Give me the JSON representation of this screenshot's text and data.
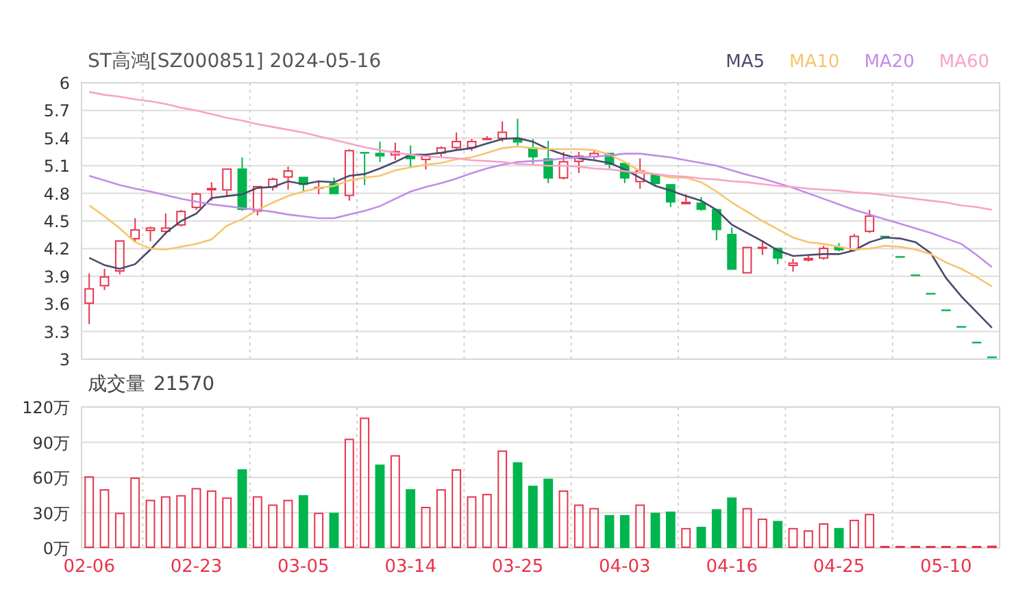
{
  "header": {
    "title": "ST高鸿[SZ000851] 2024-05-16"
  },
  "price_chart": {
    "candles": {
      "chart_data": {
        "type": "candlestick",
        "grid": true,
        "ylim": [
          3,
          6
        ],
        "yticks": [
          3,
          3.3,
          3.6,
          3.9,
          4.2,
          4.5,
          4.8,
          5.1,
          5.4,
          5.7,
          6
        ],
        "categories": [
          null,
          null,
          null,
          null,
          null,
          null,
          null,
          null,
          null,
          null,
          null,
          null,
          null,
          null,
          null,
          null,
          null,
          null,
          null,
          null,
          null,
          null,
          null,
          null,
          null,
          null,
          null,
          null,
          null,
          null,
          null,
          null,
          null,
          null,
          null,
          null,
          null,
          null,
          null,
          null,
          null,
          null,
          null,
          null,
          null,
          null,
          null,
          null,
          null,
          null,
          null,
          null,
          null,
          null,
          null,
          null,
          null,
          null,
          null,
          null
        ],
        "ohlc": [
          [
            3.6,
            3.93,
            3.38,
            3.77
          ],
          [
            3.79,
            3.98,
            3.75,
            3.9
          ],
          [
            3.95,
            4.29,
            3.92,
            4.29
          ],
          [
            4.3,
            4.53,
            4.28,
            4.41
          ],
          [
            4.39,
            4.44,
            4.28,
            4.43
          ],
          [
            4.38,
            4.58,
            4.35,
            4.43
          ],
          [
            4.45,
            4.62,
            4.44,
            4.61
          ],
          [
            4.64,
            4.81,
            4.62,
            4.8
          ],
          [
            4.84,
            4.92,
            4.72,
            4.85
          ],
          [
            4.83,
            5.07,
            4.77,
            5.07
          ],
          [
            5.07,
            5.19,
            4.61,
            4.62
          ],
          [
            4.6,
            4.88,
            4.56,
            4.88
          ],
          [
            4.86,
            4.97,
            4.83,
            4.96
          ],
          [
            4.97,
            5.09,
            4.84,
            5.05
          ],
          [
            4.98,
            4.98,
            4.82,
            4.89
          ],
          [
            4.85,
            4.94,
            4.79,
            4.87
          ],
          [
            4.91,
            4.97,
            4.79,
            4.79
          ],
          [
            4.77,
            5.28,
            4.72,
            5.27
          ],
          [
            5.24,
            5.25,
            4.89,
            5.24
          ],
          [
            5.24,
            5.36,
            5.14,
            5.2
          ],
          [
            5.21,
            5.35,
            5.16,
            5.26
          ],
          [
            5.21,
            5.32,
            5.08,
            5.17
          ],
          [
            5.16,
            5.22,
            5.06,
            5.21
          ],
          [
            5.23,
            5.31,
            5.2,
            5.3
          ],
          [
            5.29,
            5.46,
            5.27,
            5.37
          ],
          [
            5.29,
            5.39,
            5.26,
            5.37
          ],
          [
            5.38,
            5.42,
            5.38,
            5.4
          ],
          [
            5.39,
            5.58,
            5.36,
            5.47
          ],
          [
            5.4,
            5.61,
            5.32,
            5.35
          ],
          [
            5.3,
            5.39,
            5.12,
            5.19
          ],
          [
            5.18,
            5.37,
            4.91,
            4.96
          ],
          [
            4.96,
            5.25,
            4.95,
            5.15
          ],
          [
            5.14,
            5.25,
            5.02,
            5.21
          ],
          [
            5.19,
            5.27,
            5.17,
            5.24
          ],
          [
            5.24,
            5.24,
            5.07,
            5.11
          ],
          [
            5.13,
            5.13,
            4.91,
            4.96
          ],
          [
            4.92,
            5.18,
            4.85,
            5.05
          ],
          [
            5.01,
            5.01,
            4.87,
            4.9
          ],
          [
            4.9,
            4.9,
            4.65,
            4.7
          ],
          [
            4.69,
            4.79,
            4.68,
            4.7
          ],
          [
            4.7,
            4.76,
            4.61,
            4.62
          ],
          [
            4.63,
            4.63,
            4.29,
            4.4
          ],
          [
            4.36,
            4.43,
            3.97,
            3.97
          ],
          [
            3.93,
            4.22,
            3.93,
            4.22
          ],
          [
            4.2,
            4.29,
            4.13,
            4.22
          ],
          [
            4.21,
            4.21,
            4.03,
            4.09
          ],
          [
            4.01,
            4.09,
            3.95,
            4.05
          ],
          [
            4.07,
            4.13,
            4.06,
            4.1
          ],
          [
            4.09,
            4.23,
            4.08,
            4.21
          ],
          [
            4.22,
            4.26,
            4.17,
            4.18
          ],
          [
            4.18,
            4.36,
            4.17,
            4.34
          ],
          [
            4.38,
            4.62,
            4.37,
            4.56
          ],
          [
            4.33,
            4.33,
            4.33,
            4.33
          ],
          [
            4.11,
            4.11,
            4.11,
            4.11
          ],
          [
            3.91,
            3.91,
            3.91,
            3.91
          ],
          [
            3.71,
            3.71,
            3.71,
            3.71
          ],
          [
            3.53,
            3.53,
            3.53,
            3.53
          ],
          [
            3.35,
            3.35,
            3.35,
            3.35
          ],
          [
            3.18,
            3.18,
            3.18,
            3.18
          ],
          [
            3.02,
            3.02,
            3.02,
            3.02
          ]
        ]
      }
    },
    "moving_averages": {
      "chart_data": {
        "type": "line",
        "ylim": [
          3,
          6
        ],
        "categories": [
          null,
          null,
          null,
          null,
          null,
          null,
          null,
          null,
          null,
          null,
          null,
          null,
          null,
          null,
          null,
          null,
          null,
          null,
          null,
          null,
          null,
          null,
          null,
          null,
          null,
          null,
          null,
          null,
          null,
          null,
          null,
          null,
          null,
          null,
          null,
          null,
          null,
          null,
          null,
          null,
          null,
          null,
          null,
          null,
          null,
          null,
          null,
          null,
          null,
          null,
          null,
          null,
          null,
          null,
          null,
          null,
          null,
          null,
          null,
          null
        ],
        "series": [
          {
            "name": "MA5",
            "color": "#4a4a6a",
            "values": [
              4.1,
              4.02,
              3.98,
              4.03,
              4.19,
              4.37,
              4.5,
              4.58,
              4.75,
              4.77,
              4.79,
              4.86,
              4.87,
              4.93,
              4.9,
              4.93,
              4.92,
              4.99,
              5.01,
              5.07,
              5.14,
              5.22,
              5.22,
              5.24,
              5.27,
              5.29,
              5.34,
              5.39,
              5.4,
              5.36,
              5.28,
              5.22,
              5.18,
              5.16,
              5.13,
              5.06,
              4.97,
              4.88,
              4.83,
              4.77,
              4.72,
              4.62,
              4.46,
              4.37,
              4.28,
              4.18,
              4.12,
              4.13,
              4.14,
              4.14,
              4.18,
              4.27,
              4.32,
              4.31,
              4.27,
              4.15,
              3.88,
              3.68,
              3.51,
              3.34
            ]
          },
          {
            "name": "MA10",
            "color": "#f7c46c",
            "values": [
              4.67,
              4.55,
              4.42,
              4.27,
              4.2,
              4.19,
              4.22,
              4.25,
              4.3,
              4.45,
              4.52,
              4.62,
              4.7,
              4.77,
              4.82,
              4.86,
              4.88,
              4.94,
              4.97,
              4.99,
              5.05,
              5.08,
              5.11,
              5.13,
              5.17,
              5.19,
              5.24,
              5.29,
              5.31,
              5.29,
              5.28,
              5.28,
              5.28,
              5.27,
              5.22,
              5.14,
              5.04,
              5.01,
              4.97,
              4.97,
              4.92,
              4.82,
              4.7,
              4.6,
              4.5,
              4.41,
              4.32,
              4.27,
              4.25,
              4.22,
              4.19,
              4.2,
              4.23,
              4.22,
              4.19,
              4.14,
              4.05,
              3.98,
              3.89,
              3.79
            ]
          },
          {
            "name": "MA20",
            "color": "#c28ce8",
            "values": [
              4.99,
              4.94,
              4.89,
              4.85,
              4.82,
              4.78,
              4.74,
              4.71,
              4.68,
              4.66,
              4.64,
              4.62,
              4.6,
              4.57,
              4.55,
              4.53,
              4.53,
              4.57,
              4.61,
              4.66,
              4.74,
              4.82,
              4.87,
              4.91,
              4.96,
              5.02,
              5.07,
              5.11,
              5.14,
              5.15,
              5.16,
              5.18,
              5.19,
              5.2,
              5.21,
              5.23,
              5.23,
              5.21,
              5.19,
              5.16,
              5.13,
              5.1,
              5.05,
              5.0,
              4.96,
              4.91,
              4.86,
              4.8,
              4.74,
              4.68,
              4.62,
              4.57,
              4.52,
              4.47,
              4.42,
              4.37,
              4.31,
              4.25,
              4.13,
              4.0
            ]
          },
          {
            "name": "MA60",
            "color": "#f8a3c9",
            "values": [
              5.9,
              5.87,
              5.85,
              5.82,
              5.8,
              5.77,
              5.73,
              5.7,
              5.66,
              5.62,
              5.59,
              5.55,
              5.52,
              5.49,
              5.46,
              5.42,
              5.38,
              5.34,
              5.3,
              5.27,
              5.24,
              5.22,
              5.2,
              5.19,
              5.18,
              5.16,
              5.15,
              5.14,
              5.12,
              5.11,
              5.1,
              5.1,
              5.09,
              5.07,
              5.06,
              5.04,
              5.02,
              5.01,
              4.99,
              4.98,
              4.96,
              4.95,
              4.93,
              4.92,
              4.9,
              4.88,
              4.87,
              4.85,
              4.84,
              4.83,
              4.81,
              4.8,
              4.78,
              4.76,
              4.74,
              4.72,
              4.7,
              4.67,
              4.65,
              4.62
            ]
          }
        ]
      }
    }
  },
  "volume_chart": {
    "value": "21570",
    "chart_data": {
      "type": "bar",
      "grid": true,
      "ylim": [
        0,
        120
      ],
      "yticks": [
        {
          "value": 0,
          "label": "0万"
        },
        {
          "value": 30,
          "label": "30万"
        },
        {
          "value": 60,
          "label": "60万"
        },
        {
          "value": 90,
          "label": "90万"
        },
        {
          "value": 120,
          "label": "120万"
        }
      ],
      "categories": [
        "02-06",
        null,
        null,
        null,
        null,
        null,
        null,
        "02-23",
        null,
        null,
        null,
        null,
        null,
        null,
        "03-05",
        null,
        null,
        null,
        null,
        null,
        null,
        "03-14",
        null,
        null,
        null,
        null,
        null,
        null,
        "03-25",
        null,
        null,
        null,
        null,
        null,
        null,
        "04-03",
        null,
        null,
        null,
        null,
        null,
        null,
        "04-16",
        null,
        null,
        null,
        null,
        null,
        null,
        "04-25",
        null,
        null,
        null,
        null,
        null,
        null,
        "05-10",
        null,
        null,
        null
      ],
      "series": [
        {
          "name": "成交量",
          "values": [
            61,
            50,
            30,
            60,
            41,
            44,
            45,
            51,
            49,
            43,
            67,
            44,
            37,
            41,
            45,
            30,
            30,
            93,
            111,
            71,
            79,
            50,
            35,
            50,
            67,
            44,
            46,
            83,
            73,
            53,
            59,
            49,
            37,
            34,
            28,
            28,
            37,
            30,
            31,
            17,
            18,
            33,
            43,
            34,
            25,
            23,
            17,
            15,
            21,
            17,
            24,
            29,
            1,
            1,
            1,
            1,
            1,
            1,
            1,
            2
          ],
          "colors": [
            "#e8334a",
            "#e8334a",
            "#e8334a",
            "#e8334a",
            "#e8334a",
            "#e8334a",
            "#e8334a",
            "#e8334a",
            "#e8334a",
            "#e8334a",
            "#00b44e",
            "#e8334a",
            "#e8334a",
            "#e8334a",
            "#00b44e",
            "#e8334a",
            "#00b44e",
            "#e8334a",
            "#e8334a",
            "#00b44e",
            "#e8334a",
            "#00b44e",
            "#e8334a",
            "#e8334a",
            "#e8334a",
            "#e8334a",
            "#e8334a",
            "#e8334a",
            "#00b44e",
            "#00b44e",
            "#00b44e",
            "#e8334a",
            "#e8334a",
            "#e8334a",
            "#00b44e",
            "#00b44e",
            "#e8334a",
            "#00b44e",
            "#00b44e",
            "#e8334a",
            "#00b44e",
            "#00b44e",
            "#00b44e",
            "#e8334a",
            "#e8334a",
            "#00b44e",
            "#e8334a",
            "#e8334a",
            "#e8334a",
            "#00b44e",
            "#e8334a",
            "#e8334a",
            "#e8334a",
            "#e8334a",
            "#e8334a",
            "#e8334a",
            "#e8334a",
            "#e8334a",
            "#e8334a",
            "#e8334a"
          ]
        }
      ]
    }
  }
}
